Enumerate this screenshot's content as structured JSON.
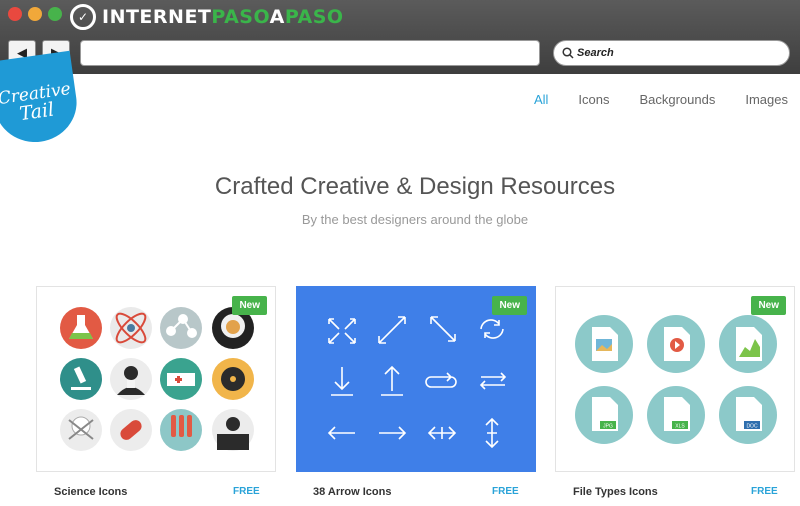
{
  "browser": {
    "logo_mark": "✓",
    "logo_text_a": "INTERNET",
    "logo_text_b": "PASO",
    "logo_text_c": "A",
    "logo_text_d": "PASO",
    "back_label": "◀",
    "forward_label": "▶",
    "search_label": "Search"
  },
  "site": {
    "logo_line1": "Creative",
    "logo_line2": "Tail",
    "nav": [
      {
        "label": "All",
        "active": true
      },
      {
        "label": "Icons",
        "active": false
      },
      {
        "label": "Backgrounds",
        "active": false
      },
      {
        "label": "Images",
        "active": false
      }
    ],
    "hero_title": "Crafted Creative & Design Resources",
    "hero_subtitle": "By the best designers around the globe"
  },
  "cards": [
    {
      "title": "Science Icons",
      "badge": "New",
      "price": "FREE"
    },
    {
      "title": "38 Arrow Icons",
      "badge": "New",
      "price": "FREE"
    },
    {
      "title": "File Types Icons",
      "badge": "New",
      "price": "FREE",
      "file_labels": [
        "JPG",
        "XLS",
        "DOC"
      ]
    }
  ],
  "colors": {
    "accent": "#29a3d8",
    "badge": "#47b34b",
    "arrow_card": "#3f7fe8"
  }
}
